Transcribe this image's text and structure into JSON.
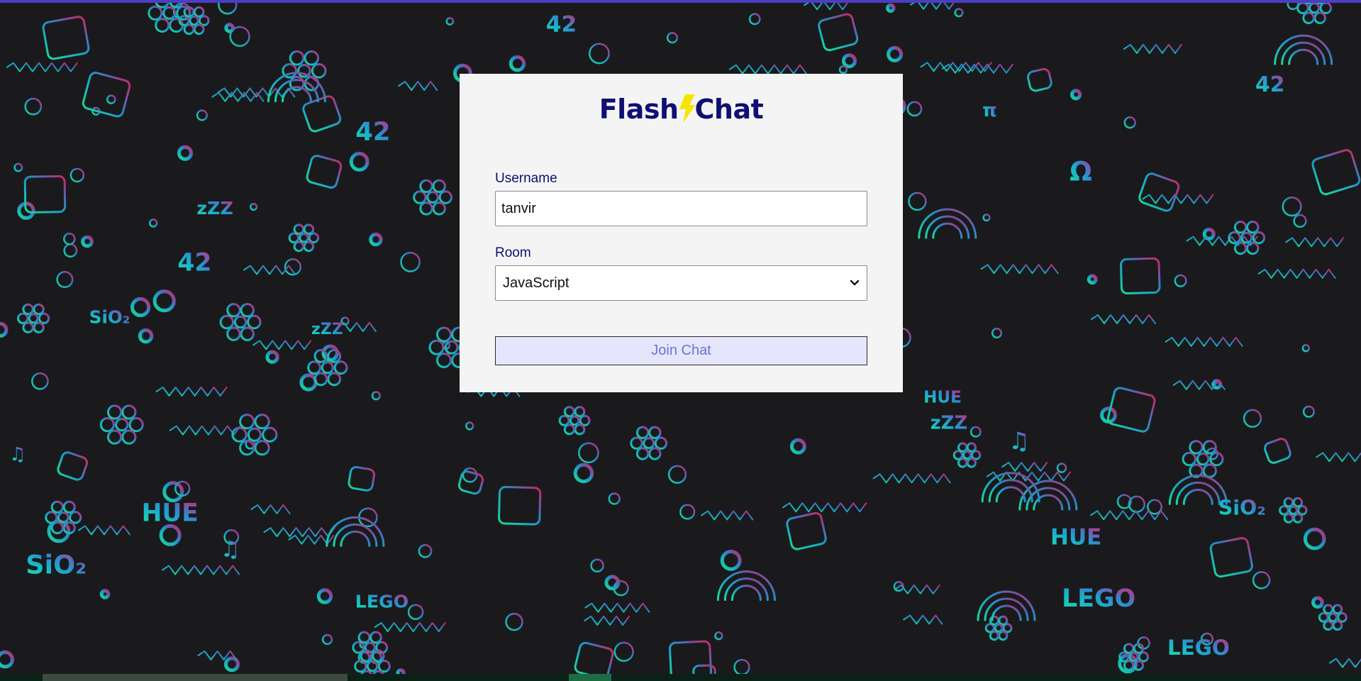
{
  "app": {
    "logo_left": "Flash",
    "logo_right": "Chat",
    "bolt_icon": "lightning-bolt-icon"
  },
  "form": {
    "username_label": "Username",
    "username_value": "tanvir",
    "room_label": "Room",
    "room_selected": "JavaScript",
    "join_label": "Join Chat"
  },
  "background": {
    "doodles": [
      "HUE",
      "42",
      "LEGO",
      "SiO₂",
      "π",
      "Ω",
      "zZZ",
      "♫"
    ]
  },
  "colors": {
    "brand": "#0f0f73",
    "bolt": "#f5e600",
    "button_bg": "#e5e6fb",
    "button_text": "#6b73d8",
    "card_bg": "#f4f4f4",
    "page_bg": "#1a1a1d"
  }
}
